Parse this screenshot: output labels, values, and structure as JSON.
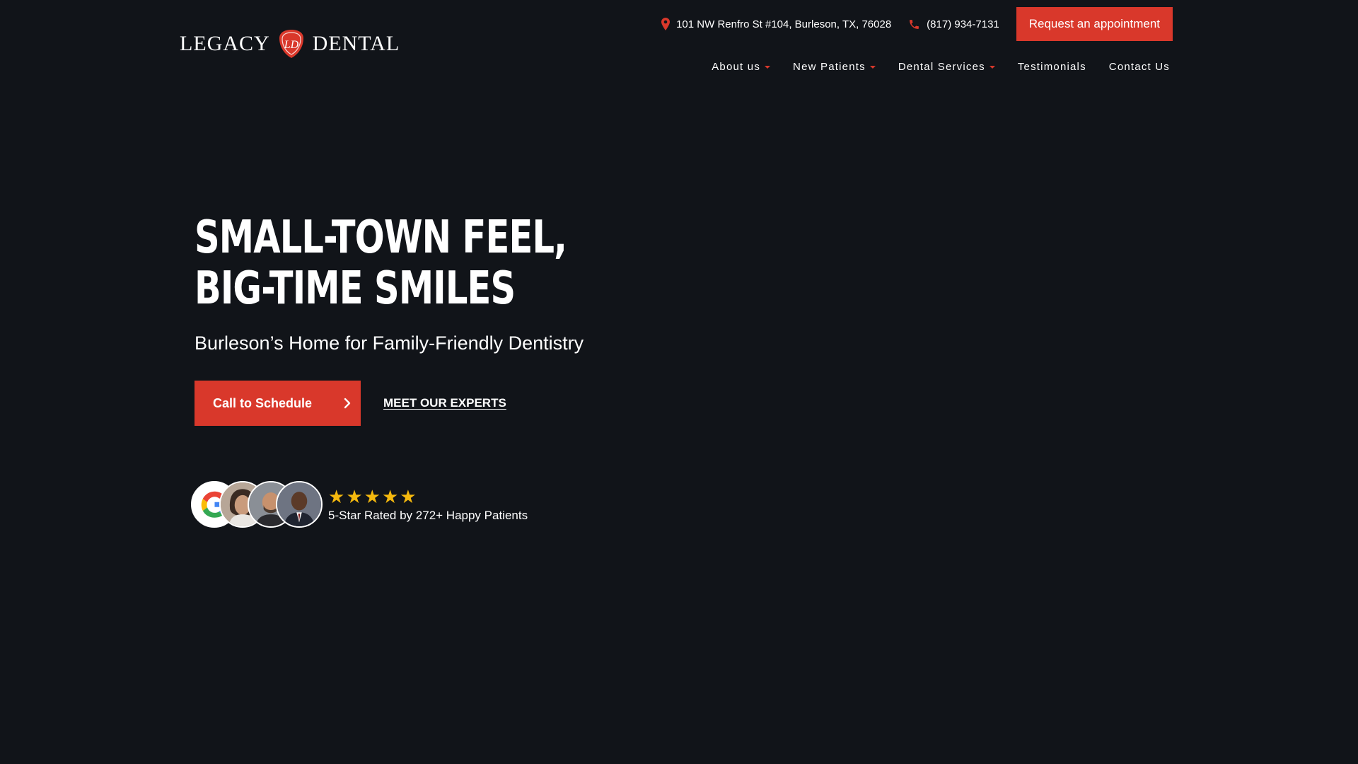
{
  "header": {
    "logo_left": "LEGACY",
    "logo_right": "DENTAL",
    "logo_monogram": "LD",
    "address": "101 NW Renfro St #104, Burleson, TX, 76028",
    "phone": "(817) 934-7131",
    "appointment_label": "Request an appointment"
  },
  "nav": {
    "items": [
      {
        "label": "About us",
        "has_dropdown": true
      },
      {
        "label": "New Patients",
        "has_dropdown": true
      },
      {
        "label": "Dental Services",
        "has_dropdown": true
      },
      {
        "label": "Testimonials",
        "has_dropdown": false
      },
      {
        "label": "Contact Us",
        "has_dropdown": false
      }
    ]
  },
  "hero": {
    "title_line1": "SMALL-TOWN FEEL,",
    "title_line2": "BIG-TIME SMILES",
    "subtitle": "Burleson’s Home for Family-Friendly Dentistry",
    "call_label": "Call to Schedule",
    "experts_label": "MEET OUR EXPERTS"
  },
  "reviews": {
    "stars": 5,
    "text": "5-Star Rated by 272+ Happy Patients"
  },
  "colors": {
    "background": "#111419",
    "accent": "#d9382b",
    "star": "#f5b90e"
  },
  "icons": {
    "address": "map-pin-icon",
    "phone": "phone-icon",
    "call_arrow": "chevron-right-icon",
    "review_source": "google-icon"
  }
}
